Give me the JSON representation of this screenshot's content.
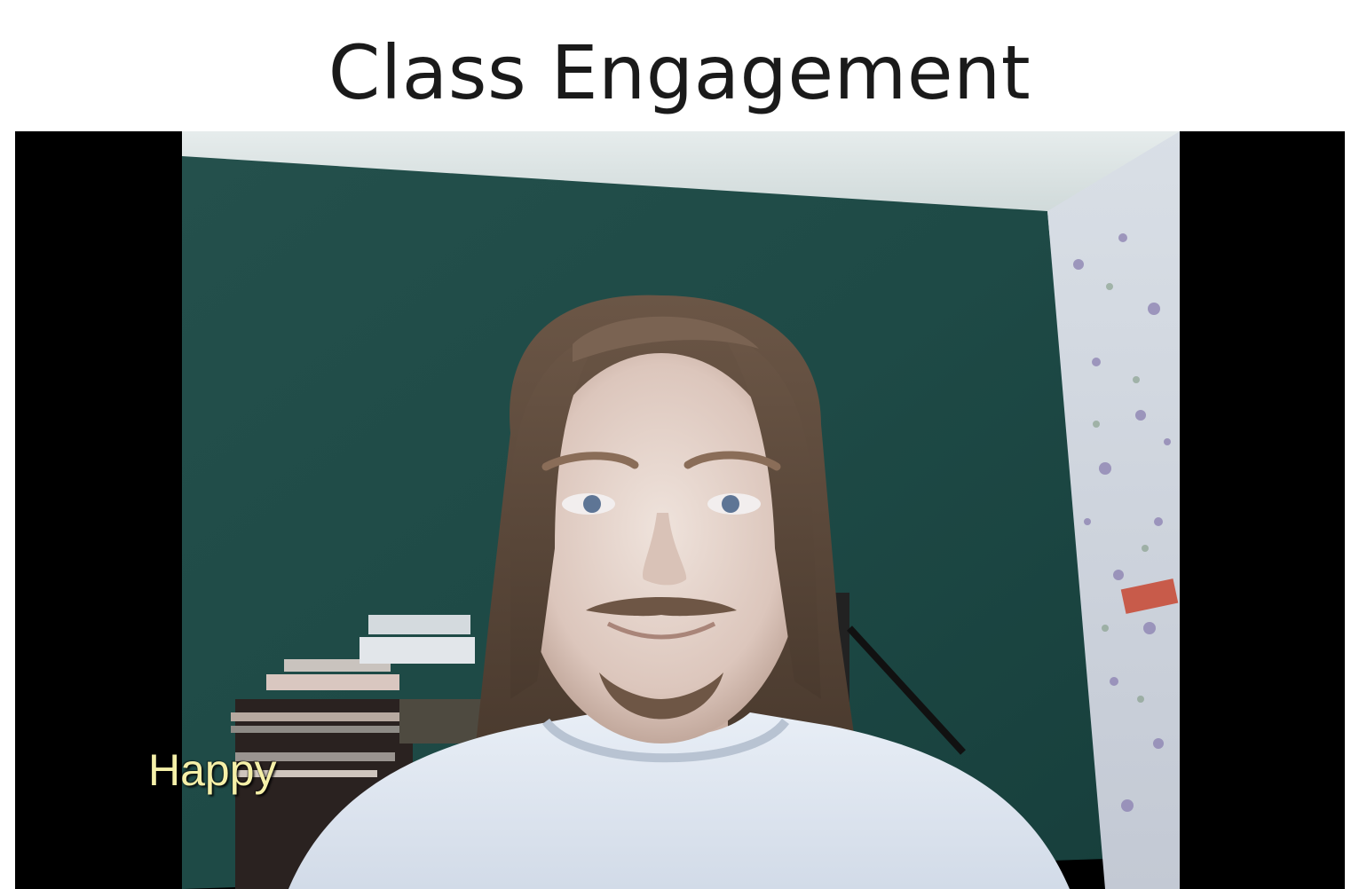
{
  "header": {
    "title": "Class Engagement"
  },
  "video": {
    "emotion_label": "Happy",
    "label_color": "#f5f0a8",
    "letterbox_color": "#000000"
  }
}
